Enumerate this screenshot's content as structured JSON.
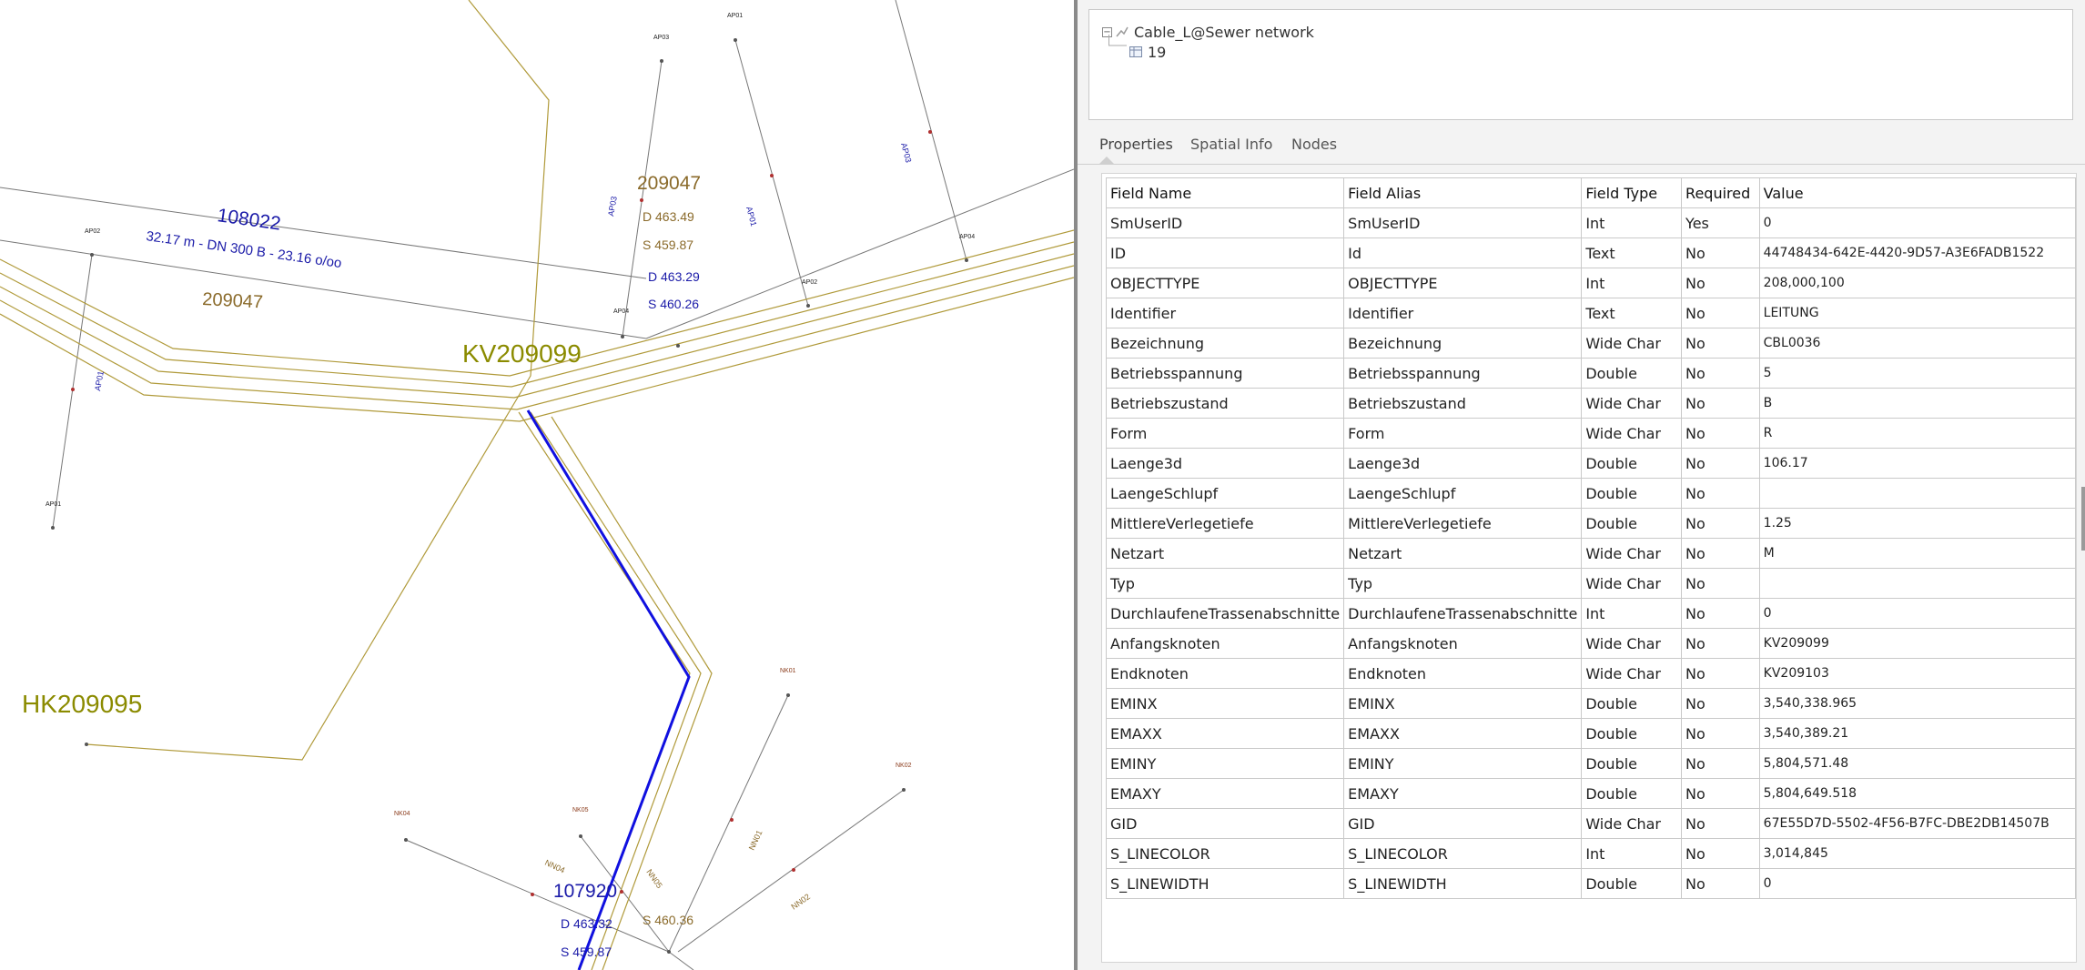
{
  "map": {
    "labels": {
      "kv": "KV209099",
      "hk": "HK209095",
      "id_108022": "108022",
      "dims": "32.17 m - DN 300 B - 23.16 o/oo",
      "id_209047_a": "209047",
      "id_209047_b": "209047",
      "d_463_49": "D 463.49",
      "s_459_87_a": "S 459.87",
      "d_463_29": "D 463.29",
      "s_460_26": "S 460.26",
      "id_107920": "107920",
      "d_463_32": "D 463.32",
      "s_459_87_b": "S 459.87",
      "s_460_36": "S 460.36",
      "ap03_top": "AP03",
      "ap01_top": "AP01",
      "ap02_left": "AP02",
      "ap01_left": "AP01",
      "ap03_mid": "AP03",
      "ap02_right": "AP02",
      "ap04_right": "AP04",
      "ap04_mid": "AP04",
      "ap03_diag": "AP03",
      "ap01_diag": "AP01",
      "ap03_far": "AP03",
      "ap01_vert": "AP01",
      "nk01": "NK01",
      "nk02": "NK02",
      "nk04": "NK04",
      "nk05": "NK05",
      "nn01": "NN01",
      "nn02": "NN02",
      "nn04": "NN04",
      "nn05": "NN05"
    },
    "colors": {
      "selected_line": "#1010e0",
      "cable": "#b09a3a",
      "node_label": "#8b8b00",
      "pipe_id": "#1a1aa8",
      "depth": "#8a6a2a"
    }
  },
  "tree": {
    "layer_label": "Cable_L@Sewer network",
    "record_label": "19",
    "expander_symbol": "−"
  },
  "tabs": [
    {
      "label": "Properties",
      "active": true
    },
    {
      "label": "Spatial Info",
      "active": false
    },
    {
      "label": "Nodes",
      "active": false
    }
  ],
  "table": {
    "headers": {
      "name": "Field Name",
      "alias": "Field Alias",
      "type": "Field Type",
      "required": "Required",
      "value": "Value"
    },
    "rows": [
      [
        "SmUserID",
        "SmUserID",
        "Int",
        "Yes",
        "0"
      ],
      [
        "ID",
        "Id",
        "Text",
        "No",
        "44748434-642E-4420-9D57-A3E6FADB1522"
      ],
      [
        "OBJECTTYPE",
        "OBJECTTYPE",
        "Int",
        "No",
        "208,000,100"
      ],
      [
        "Identifier",
        "Identifier",
        "Text",
        "No",
        "LEITUNG"
      ],
      [
        "Bezeichnung",
        "Bezeichnung",
        "Wide Char",
        "No",
        "CBL0036"
      ],
      [
        "Betriebsspannung",
        "Betriebsspannung",
        "Double",
        "No",
        "5"
      ],
      [
        "Betriebszustand",
        "Betriebszustand",
        "Wide Char",
        "No",
        "B"
      ],
      [
        "Form",
        "Form",
        "Wide Char",
        "No",
        "R"
      ],
      [
        "Laenge3d",
        "Laenge3d",
        "Double",
        "No",
        "106.17"
      ],
      [
        "LaengeSchlupf",
        "LaengeSchlupf",
        "Double",
        "No",
        ""
      ],
      [
        "MittlereVerlegetiefe",
        "MittlereVerlegetiefe",
        "Double",
        "No",
        "1.25"
      ],
      [
        "Netzart",
        "Netzart",
        "Wide Char",
        "No",
        "M"
      ],
      [
        "Typ",
        "Typ",
        "Wide Char",
        "No",
        ""
      ],
      [
        "DurchlaufeneTrassenabschnitte",
        "DurchlaufeneTrassenabschnitte",
        "Int",
        "No",
        "0"
      ],
      [
        "Anfangsknoten",
        "Anfangsknoten",
        "Wide Char",
        "No",
        "KV209099"
      ],
      [
        "Endknoten",
        "Endknoten",
        "Wide Char",
        "No",
        "KV209103"
      ],
      [
        "EMINX",
        "EMINX",
        "Double",
        "No",
        "3,540,338.965"
      ],
      [
        "EMAXX",
        "EMAXX",
        "Double",
        "No",
        "3,540,389.21"
      ],
      [
        "EMINY",
        "EMINY",
        "Double",
        "No",
        "5,804,571.48"
      ],
      [
        "EMAXY",
        "EMAXY",
        "Double",
        "No",
        "5,804,649.518"
      ],
      [
        "GID",
        "GID",
        "Wide Char",
        "No",
        "67E55D7D-5502-4F56-B7FC-DBE2DB14507B"
      ],
      [
        "S_LINECOLOR",
        "S_LINECOLOR",
        "Int",
        "No",
        "3,014,845"
      ],
      [
        "S_LINEWIDTH",
        "S_LINEWIDTH",
        "Double",
        "No",
        "0"
      ]
    ]
  }
}
